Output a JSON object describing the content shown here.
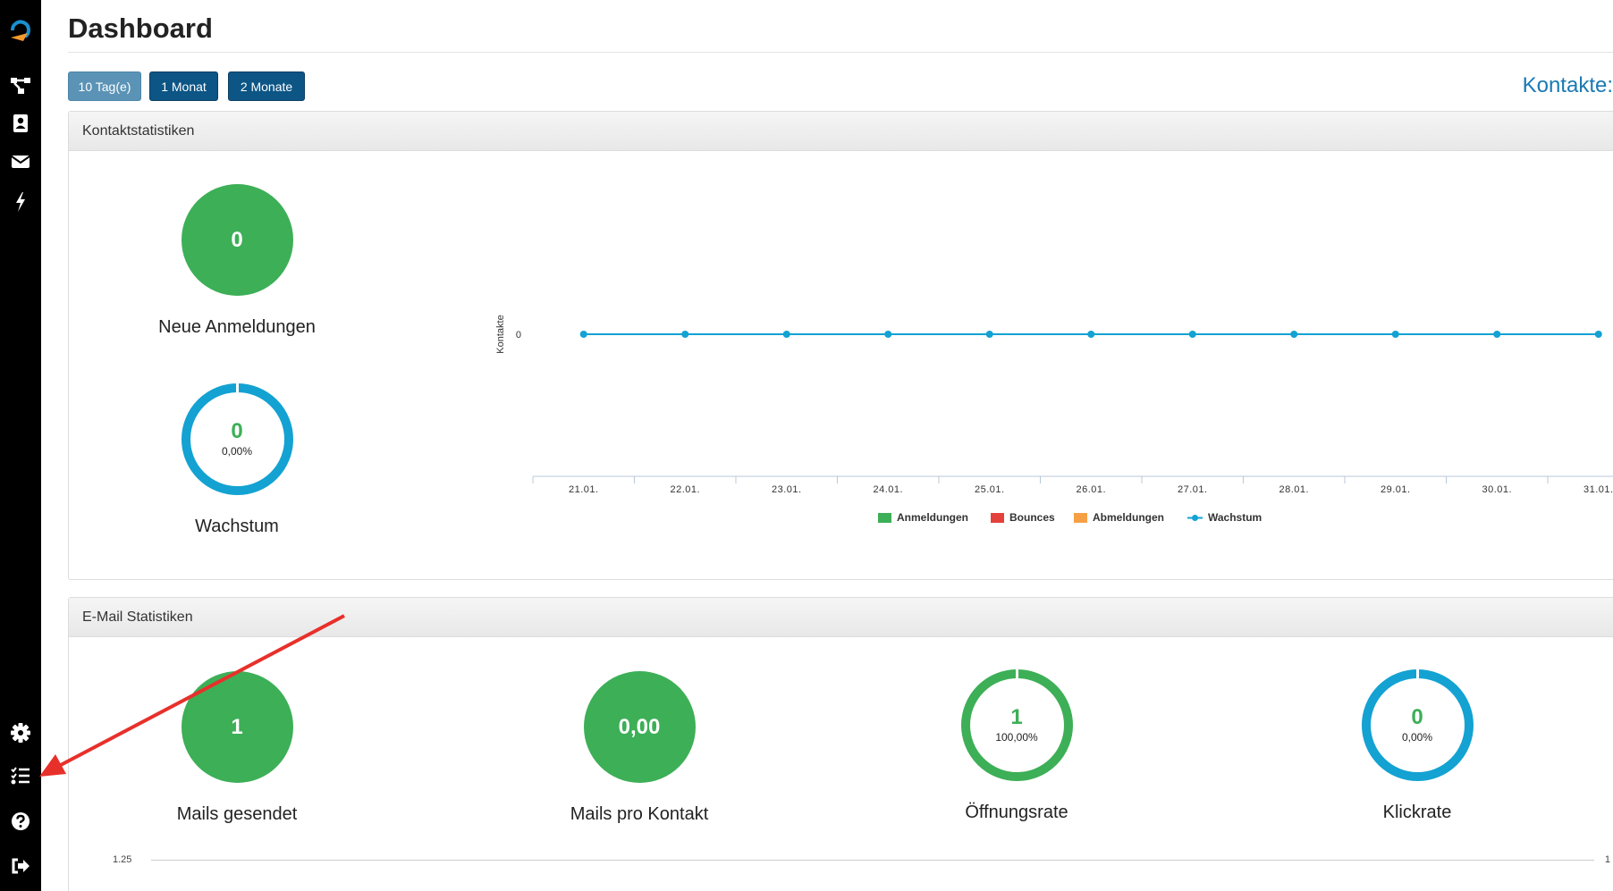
{
  "sidebar": {
    "items": [
      {
        "icon": "logo-icon"
      },
      {
        "icon": "sitemap-icon"
      },
      {
        "icon": "contact-book-icon"
      },
      {
        "icon": "envelope-icon"
      },
      {
        "icon": "bolt-icon"
      },
      {
        "icon": "gear-icon"
      },
      {
        "icon": "list-check-icon"
      },
      {
        "icon": "help-icon"
      },
      {
        "icon": "sign-out-icon"
      }
    ]
  },
  "header": {
    "title": "Dashboard",
    "range_buttons": [
      "10 Tag(e)",
      "1 Monat",
      "2 Monate"
    ],
    "active_range": "10 Tag(e)",
    "contacts_label": "Kontakte:"
  },
  "contact_stats": {
    "title": "Kontaktstatistiken",
    "new_signups": {
      "value": "0",
      "label": "Neue Anmeldungen"
    },
    "growth": {
      "value": "0",
      "percent": "0,00%",
      "label": "Wachstum"
    }
  },
  "email_stats": {
    "title": "E-Mail Statistiken",
    "mails_sent": {
      "value": "1",
      "label": "Mails gesendet"
    },
    "mails_per_contact": {
      "value": "0,00",
      "label": "Mails pro Kontakt"
    },
    "open_rate": {
      "value": "1",
      "percent": "100,00%",
      "label": "Öffnungsrate"
    },
    "click_rate": {
      "value": "0",
      "percent": "0,00%",
      "label": "Klickrate"
    },
    "chart_ticks": {
      "left": "1.25",
      "right": "1"
    }
  },
  "colors": {
    "accent": "#1a7ab4",
    "green": "#3daf57",
    "blue": "#13a2d2",
    "red": "#e4413c",
    "orange": "#f6a046",
    "sidebar": "#000000",
    "annotation_arrow": "#e8302a"
  },
  "chart_data": {
    "type": "line",
    "x": [
      "21.01.",
      "22.01.",
      "23.01.",
      "24.01.",
      "25.01.",
      "26.01.",
      "27.01.",
      "28.01.",
      "29.01.",
      "30.01.",
      "31.01."
    ],
    "ylabel": "Kontakte",
    "yticks": [
      "0"
    ],
    "legend": [
      "Anmeldungen",
      "Bounces",
      "Abmeldungen",
      "Wachstum"
    ],
    "legend_colors": [
      "#3daf57",
      "#e4413c",
      "#f6a046",
      "#13a2d2"
    ],
    "series": [
      {
        "name": "Wachstum",
        "values": [
          0,
          0,
          0,
          0,
          0,
          0,
          0,
          0,
          0,
          0,
          0
        ]
      }
    ]
  }
}
